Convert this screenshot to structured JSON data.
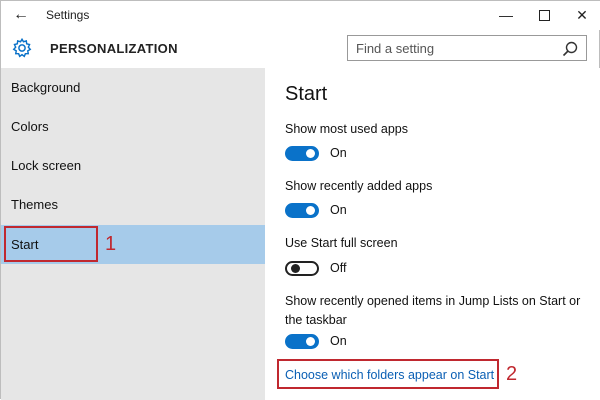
{
  "window": {
    "title": "Settings",
    "back_glyph": "←",
    "controls": {
      "minimize": "—",
      "close": "✕"
    }
  },
  "header": {
    "section_title": "PERSONALIZATION",
    "search_placeholder": "Find a setting"
  },
  "sidebar": {
    "items": [
      {
        "label": "Background"
      },
      {
        "label": "Colors"
      },
      {
        "label": "Lock screen"
      },
      {
        "label": "Themes"
      },
      {
        "label": "Start",
        "selected": true
      }
    ]
  },
  "main": {
    "title": "Start",
    "settings": [
      {
        "label": "Show most used apps",
        "state": "On"
      },
      {
        "label": "Show recently added apps",
        "state": "On"
      },
      {
        "label": "Use Start full screen",
        "state": "Off"
      },
      {
        "label": "Show recently opened items in Jump Lists on Start or the taskbar",
        "state": "On"
      }
    ],
    "link": "Choose which folders appear on Start"
  },
  "annotations": {
    "step1": "1",
    "step2": "2",
    "color": "#c0282f"
  },
  "colors": {
    "accent": "#0a72c9",
    "selected_nav": "#a6cbea",
    "sidebar_bg": "#e6e6e6",
    "link": "#0a5fb4"
  },
  "icons": {
    "back": "back-arrow-icon",
    "gear": "gear-icon",
    "search": "search-icon"
  }
}
